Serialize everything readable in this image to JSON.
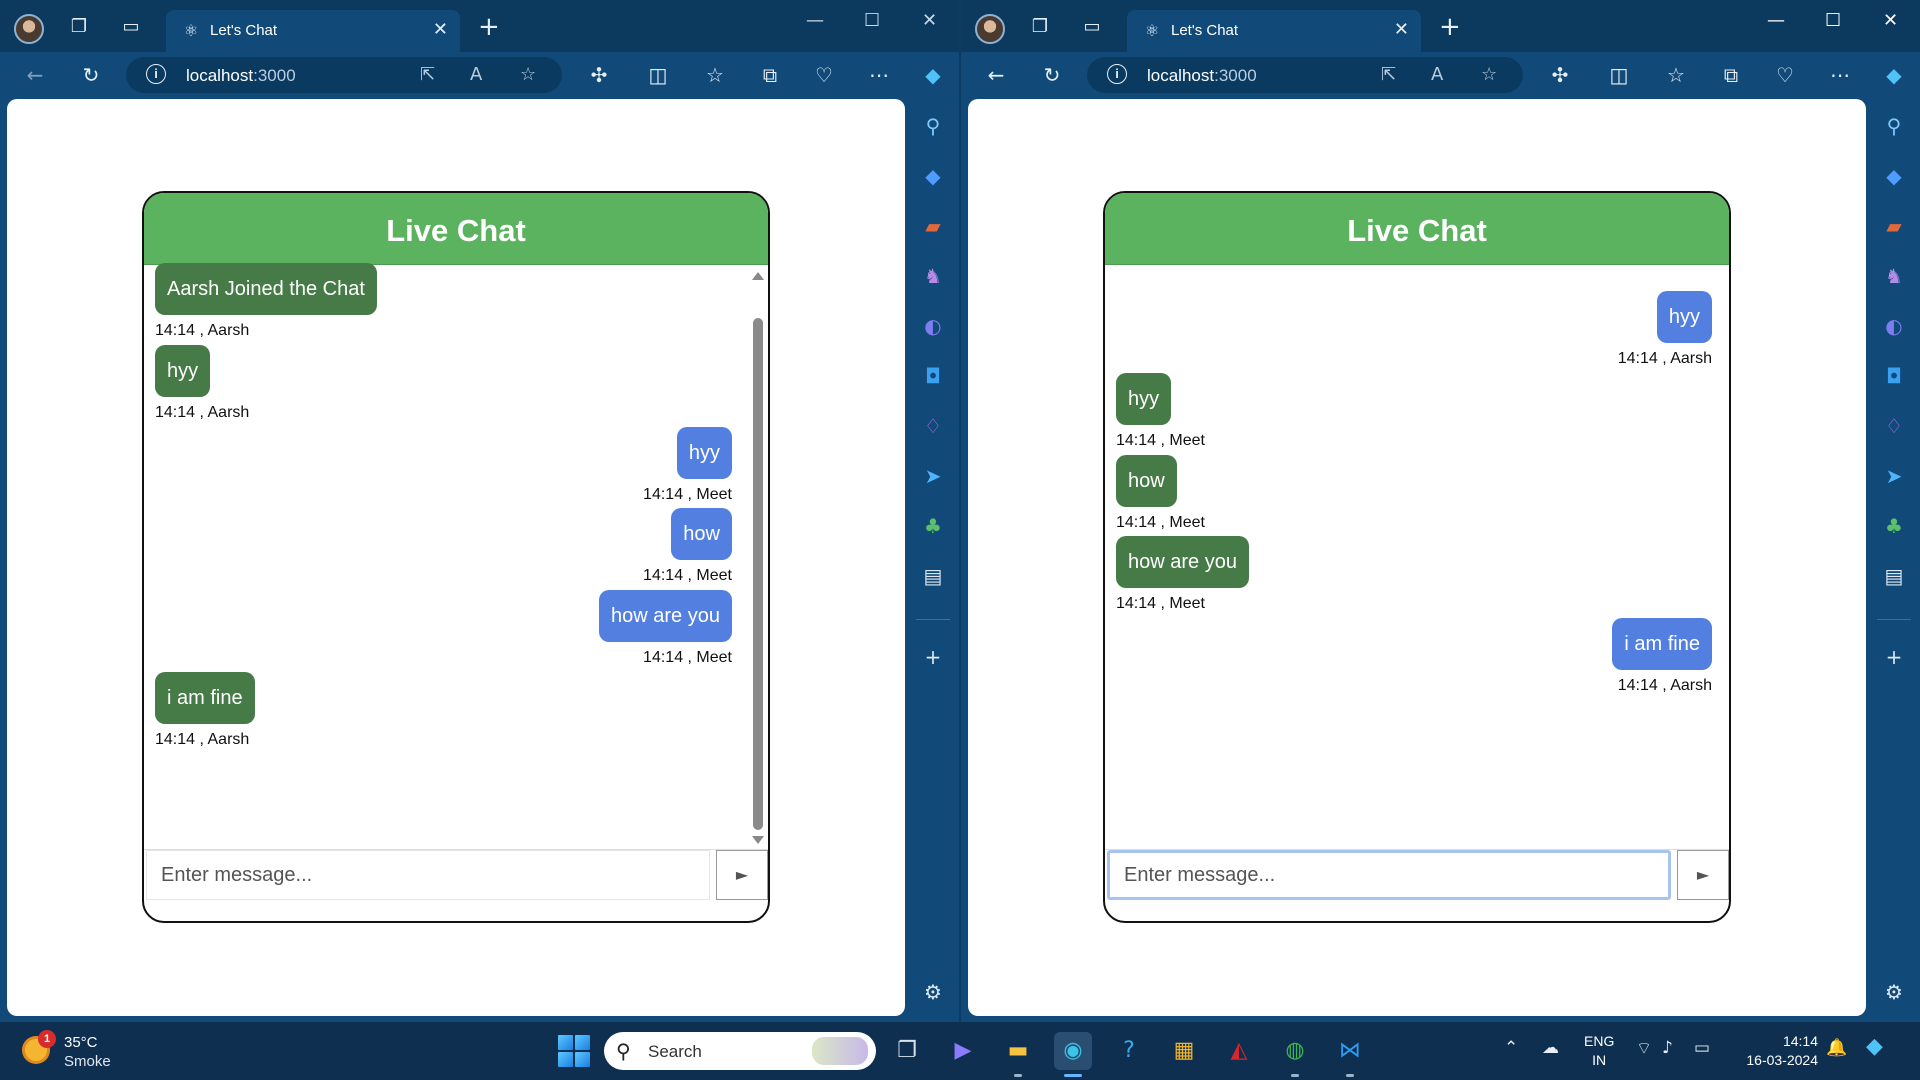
{
  "browser": {
    "tab_title": "Let's Chat",
    "address_host": "localhost",
    "address_port": ":3000"
  },
  "app": {
    "title": "Live Chat",
    "input_placeholder": "Enter message...",
    "send_label": "►"
  },
  "left_pane": {
    "messages": [
      {
        "text": "Aarsh Joined the Chat",
        "meta": "14:14 , Aarsh",
        "side": "left"
      },
      {
        "text": "hyy",
        "meta": "14:14 , Aarsh",
        "side": "left"
      },
      {
        "text": "hyy",
        "meta": "14:14 , Meet",
        "side": "right"
      },
      {
        "text": "how",
        "meta": "14:14 , Meet",
        "side": "right"
      },
      {
        "text": "how are you",
        "meta": "14:14 , Meet",
        "side": "right"
      },
      {
        "text": "i am fine",
        "meta": "14:14 , Aarsh",
        "side": "left"
      }
    ]
  },
  "right_pane": {
    "messages": [
      {
        "text": "hyy",
        "meta": "14:14 , Aarsh",
        "side": "right"
      },
      {
        "text": "hyy",
        "meta": "14:14 , Meet",
        "side": "left"
      },
      {
        "text": "how",
        "meta": "14:14 , Meet",
        "side": "left"
      },
      {
        "text": "how are you",
        "meta": "14:14 , Meet",
        "side": "left"
      },
      {
        "text": "i am fine",
        "meta": "14:14 , Aarsh",
        "side": "right"
      }
    ]
  },
  "taskbar": {
    "weather_badge": "1",
    "weather_temp": "35°C",
    "weather_cond": "Smoke",
    "search_text": "Search",
    "lang_line1": "ENG",
    "lang_line2": "IN",
    "time": "14:14",
    "date": "16-03-2024"
  },
  "colors": {
    "header_green": "#5cb35f",
    "incoming_bubble": "#467b48",
    "outgoing_bubble": "#5380e0",
    "browser_chrome": "#114a78"
  }
}
